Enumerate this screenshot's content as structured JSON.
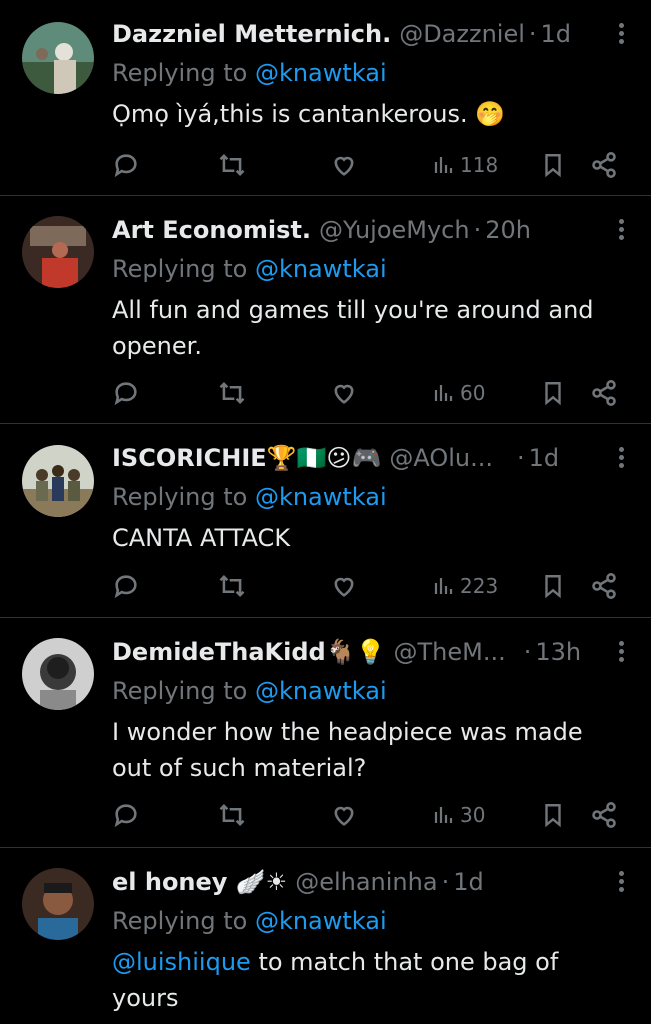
{
  "replies": [
    {
      "name": "Dazzniel Metternich.",
      "handle": "@Dazzniel",
      "time": "1d",
      "replying_prefix": "Replying to ",
      "replying_to": "@knawtkai",
      "text": "Ọmọ ìyá,this is cantankerous. 🤭",
      "views": "118",
      "avatar_color": "#4f6d63"
    },
    {
      "name": "Art Economist.",
      "handle": "@YujoeMych",
      "time": "20h",
      "replying_prefix": "Replying to ",
      "replying_to": "@knawtkai",
      "text": "All fun and games till you're around and opener.",
      "views": "60",
      "avatar_color": "#7a3a32"
    },
    {
      "name": "ISCORICHIE🏆🇳🇬😕🎮",
      "handle": "@AOlu...",
      "time": "1d",
      "replying_prefix": "Replying to ",
      "replying_to": "@knawtkai",
      "text": "CANTA ATTACK",
      "views": "223",
      "avatar_color": "#8a8a6a"
    },
    {
      "name": "DemideThaKidd🐐💡",
      "handle": "@TheM...",
      "time": "13h",
      "replying_prefix": "Replying to ",
      "replying_to": "@knawtkai",
      "text": "I wonder how the headpiece was made out of such material?",
      "views": "30",
      "avatar_color": "#9a9a9a"
    },
    {
      "name": "el honey 🪽☀",
      "handle": "@elhaninha",
      "time": "1d",
      "replying_prefix": "Replying to ",
      "replying_to": "@knawtkai",
      "text_mention": "@luishiique",
      "text": " to match that one bag of yours",
      "avatar_color": "#6b4a3a"
    }
  ],
  "colors": {
    "background": "#000000",
    "muted": "#71767b",
    "accent": "#1d9bf0",
    "divider": "#2f3336"
  },
  "icons": [
    "reply-icon",
    "retweet-icon",
    "like-icon",
    "views-icon",
    "bookmark-icon",
    "share-icon",
    "more-icon"
  ]
}
